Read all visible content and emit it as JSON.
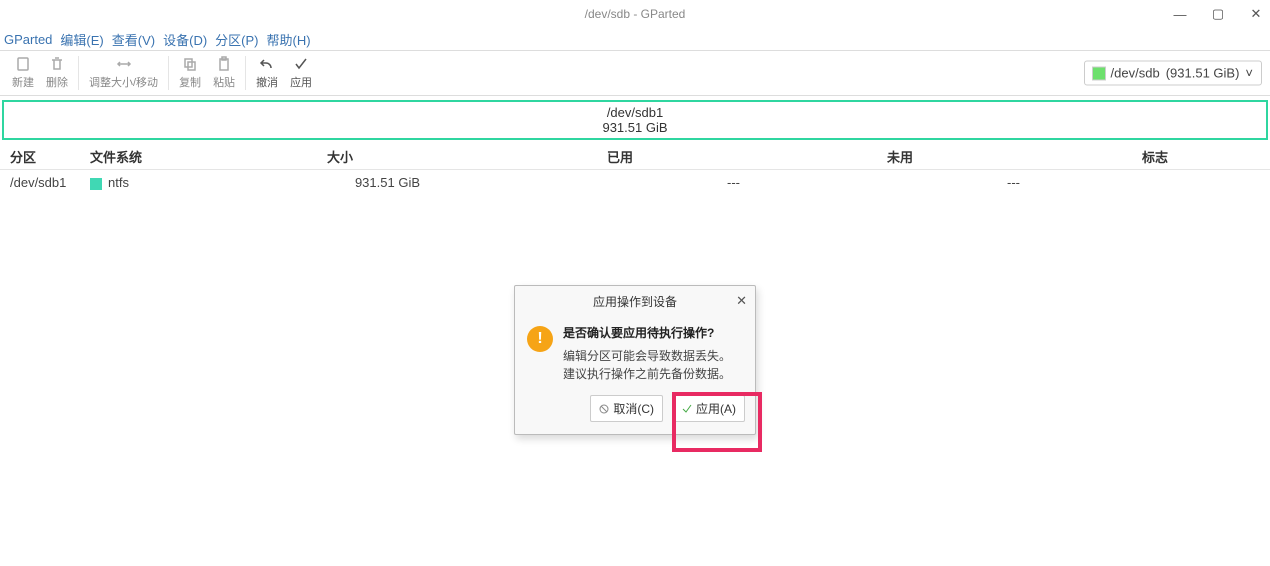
{
  "window": {
    "title": "/dev/sdb - GParted"
  },
  "menu": {
    "app": "GParted",
    "edit": "编辑(E)",
    "view": "查看(V)",
    "device": "设备(D)",
    "partition": "分区(P)",
    "help": "帮助(H)"
  },
  "toolbar": {
    "new": "新建",
    "delete": "删除",
    "resize": "调整大小/移动",
    "copy": "复制",
    "paste": "粘贴",
    "undo": "撤消",
    "apply": "应用"
  },
  "device_select": {
    "name": "/dev/sdb",
    "size": "(931.51 GiB)"
  },
  "partbar": {
    "name": "/dev/sdb1",
    "size": "931.51 GiB"
  },
  "columns": {
    "partition": "分区",
    "filesystem": "文件系统",
    "size": "大小",
    "used": "已用",
    "unused": "未用",
    "flags": "标志"
  },
  "rows": [
    {
      "partition": "/dev/sdb1",
      "fs": "ntfs",
      "size": "931.51 GiB",
      "used": "---",
      "unused": "---",
      "flags": ""
    }
  ],
  "dialog": {
    "title": "应用操作到设备",
    "question": "是否确认要应用待执行操作?",
    "line1": "编辑分区可能会导致数据丢失。",
    "line2": "建议执行操作之前先备份数据。",
    "cancel": "取消(C)",
    "apply": "应用(A)"
  }
}
